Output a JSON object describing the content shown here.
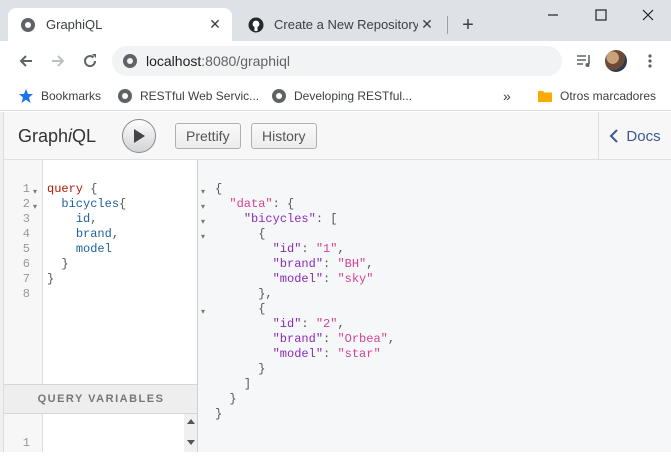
{
  "browser": {
    "tabs": [
      {
        "title": "GraphiQL",
        "icon": "globe-icon",
        "active": true
      },
      {
        "title": "Create a New Repository",
        "icon": "github-icon",
        "active": false
      }
    ],
    "new_tab_label": "+",
    "url": {
      "host": "localhost",
      "path": ":8080/graphiql"
    },
    "bookmarks": [
      {
        "label": "Bookmarks",
        "icon": "star-icon"
      },
      {
        "label": "RESTful Web Servic...",
        "icon": "globe-icon"
      },
      {
        "label": "Developing RESTful...",
        "icon": "globe-icon"
      }
    ],
    "bookmarks_more": "»",
    "other_bookmarks": "Otros marcadores"
  },
  "graphiql": {
    "title_pre": "Graph",
    "title_i": "i",
    "title_post": "QL",
    "prettify_label": "Prettify",
    "history_label": "History",
    "docs_label": "Docs",
    "query_variables_label": "QUERY VARIABLES",
    "query_variables_line": "1",
    "query_lines": [
      {
        "n": "1",
        "fold": "▾"
      },
      {
        "n": "2",
        "fold": "▾"
      },
      {
        "n": "3",
        "fold": ""
      },
      {
        "n": "4",
        "fold": ""
      },
      {
        "n": "5",
        "fold": ""
      },
      {
        "n": "6",
        "fold": ""
      },
      {
        "n": "7",
        "fold": ""
      },
      {
        "n": "8",
        "fold": ""
      }
    ],
    "query": {
      "keyword": "query",
      "root_field": "bicycles",
      "fields": [
        "id",
        "brand",
        "model"
      ]
    },
    "result": {
      "root_key": "\"data\"",
      "list_key": "\"bicycles\"",
      "items": [
        {
          "id": "\"1\"",
          "brand": "\"BH\"",
          "model": "\"sky\""
        },
        {
          "id": "\"2\"",
          "brand": "\"Orbea\"",
          "model": "\"star\""
        }
      ],
      "keys": {
        "id": "\"id\"",
        "brand": "\"brand\"",
        "model": "\"model\""
      }
    }
  },
  "colors": {
    "keyword": "#b11a04",
    "field": "#1f61a0",
    "string": "#d64292",
    "attribute": "#8b2bb9",
    "link": "#3b5998"
  }
}
